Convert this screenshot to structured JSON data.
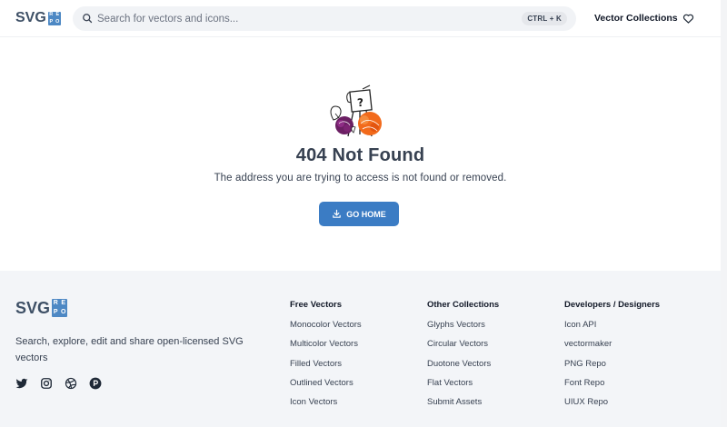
{
  "header": {
    "logo_text": "SVG",
    "logo_box": [
      "R",
      "E",
      "P",
      "O"
    ],
    "search_placeholder": "Search for vectors and icons...",
    "search_shortcut": "CTRL + K",
    "nav_collections": "Vector Collections",
    "icons": {
      "search": "search-icon",
      "favorites": "heart-icon"
    }
  },
  "main": {
    "title": "404 Not Found",
    "message": "The address you are trying to access is not found or removed.",
    "button_label": "GO HOME",
    "button_icon": "download-icon",
    "accent": "#3b7cc4"
  },
  "footer": {
    "logo_text": "SVG",
    "logo_box": [
      "R",
      "E",
      "P",
      "O"
    ],
    "tagline": "Search, explore, edit and share open-licensed SVG vectors",
    "socials": [
      "twitter-icon",
      "instagram-icon",
      "dribbble-icon",
      "producthunt-icon"
    ],
    "columns": [
      {
        "heading": "Free Vectors",
        "links": [
          "Monocolor Vectors",
          "Multicolor Vectors",
          "Filled Vectors",
          "Outlined Vectors",
          "Icon Vectors"
        ]
      },
      {
        "heading": "Other Collections",
        "links": [
          "Glyphs Vectors",
          "Circular Vectors",
          "Duotone Vectors",
          "Flat Vectors",
          "Submit Assets"
        ]
      },
      {
        "heading": "Developers / Designers",
        "links": [
          "Icon API",
          "vectormaker",
          "PNG Repo",
          "Font Repo",
          "UIUX Repo"
        ]
      }
    ],
    "background": "#f3f5f8"
  }
}
